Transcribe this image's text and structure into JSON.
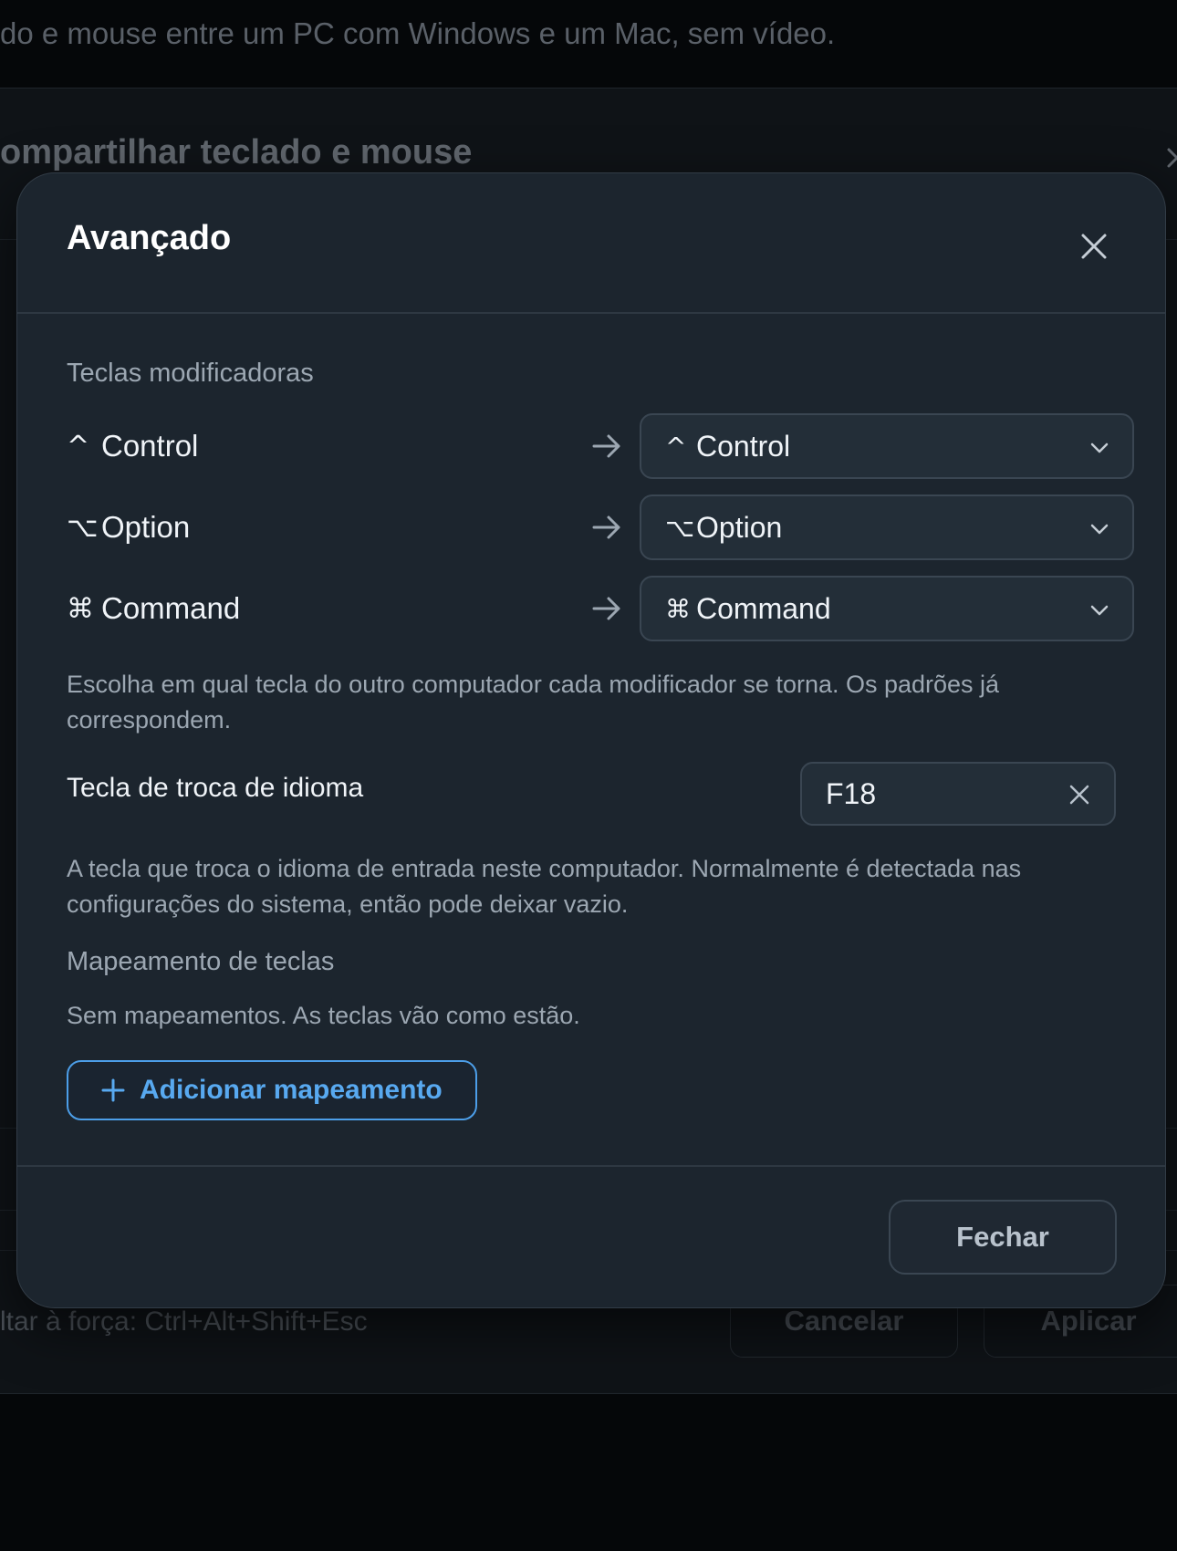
{
  "background": {
    "subtitle": "do e mouse entre um PC com Windows e um Mac, sem vídeo.",
    "panel_title": "ompartilhar teclado e mouse",
    "footer_note": "ltar à força: Ctrl+Alt+Shift+Esc",
    "cancel_label": "Cancelar",
    "apply_label": "Aplicar"
  },
  "modal": {
    "title": "Avançado",
    "modifiers": {
      "section_label": "Teclas modificadoras",
      "rows": [
        {
          "source_glyph": "^",
          "source_label": "Control",
          "target_glyph": "^",
          "target_label": "Control"
        },
        {
          "source_glyph": "⌥",
          "source_label": "Option",
          "target_glyph": "⌥",
          "target_label": "Option"
        },
        {
          "source_glyph": "⌘",
          "source_label": "Command",
          "target_glyph": "⌘",
          "target_label": "Command"
        }
      ],
      "help": "Escolha em qual tecla do outro computador cada modificador se torna. Os padrões já correspondem."
    },
    "language_key": {
      "label": "Tecla de troca de idioma",
      "value": "F18",
      "help": "A tecla que troca o idioma de entrada neste computador. Normalmente é detectada nas configurações do sistema, então pode deixar vazio."
    },
    "key_mapping": {
      "section_label": "Mapeamento de teclas",
      "empty_text": "Sem mapeamentos. As teclas vão como estão.",
      "add_label": "Adicionar mapeamento"
    },
    "close_label": "Fechar"
  },
  "colors": {
    "modal_bg": "#1c252e",
    "accent": "#58a9f0",
    "page_bg": "#050709"
  },
  "icons": [
    "close-icon",
    "arrow-right-icon",
    "chevron-down-icon",
    "clear-icon",
    "plus-icon"
  ]
}
